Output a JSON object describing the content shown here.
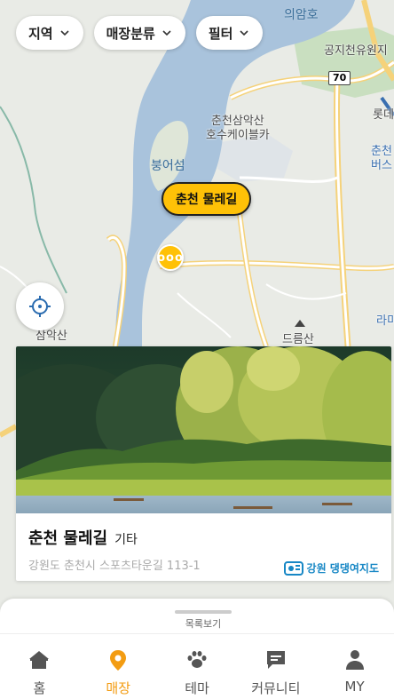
{
  "filters": [
    {
      "label": "지역"
    },
    {
      "label": "매장분류"
    },
    {
      "label": "필터"
    }
  ],
  "map": {
    "labels": {
      "uiamho": "의암호",
      "gongji": "공지천유원지",
      "road_no": "70",
      "lotte": "롯데",
      "samaksan_cable": "춘천삼악산\n호수케이블카",
      "bungeoseom": "붕어섬",
      "chuncheon_bus": "춘천\n버스",
      "samaksan": "삼악산",
      "deureumsan": "드름산",
      "lami": "라미"
    },
    "marker_label": "춘천 물레길",
    "cluster_label": "ooo"
  },
  "card": {
    "title": "춘천 물레길",
    "category": "기타",
    "address": "강원도 춘천시 스포츠타운길 113-1",
    "logo_text": "강원 댕댕여지도"
  },
  "sheet": {
    "label": "목록보기"
  },
  "tabs": [
    {
      "label": "홈",
      "icon": "home-icon",
      "active": false
    },
    {
      "label": "매장",
      "icon": "location-pin-icon",
      "active": true
    },
    {
      "label": "테마",
      "icon": "paw-icon",
      "active": false
    },
    {
      "label": "커뮤니티",
      "icon": "chat-bubble-icon",
      "active": false
    },
    {
      "label": "MY",
      "icon": "person-icon",
      "active": false
    }
  ],
  "colors": {
    "accent": "#ffc107",
    "active_tab": "#f39c12",
    "water": "#a9c3dc",
    "land": "#e9ebe6"
  }
}
